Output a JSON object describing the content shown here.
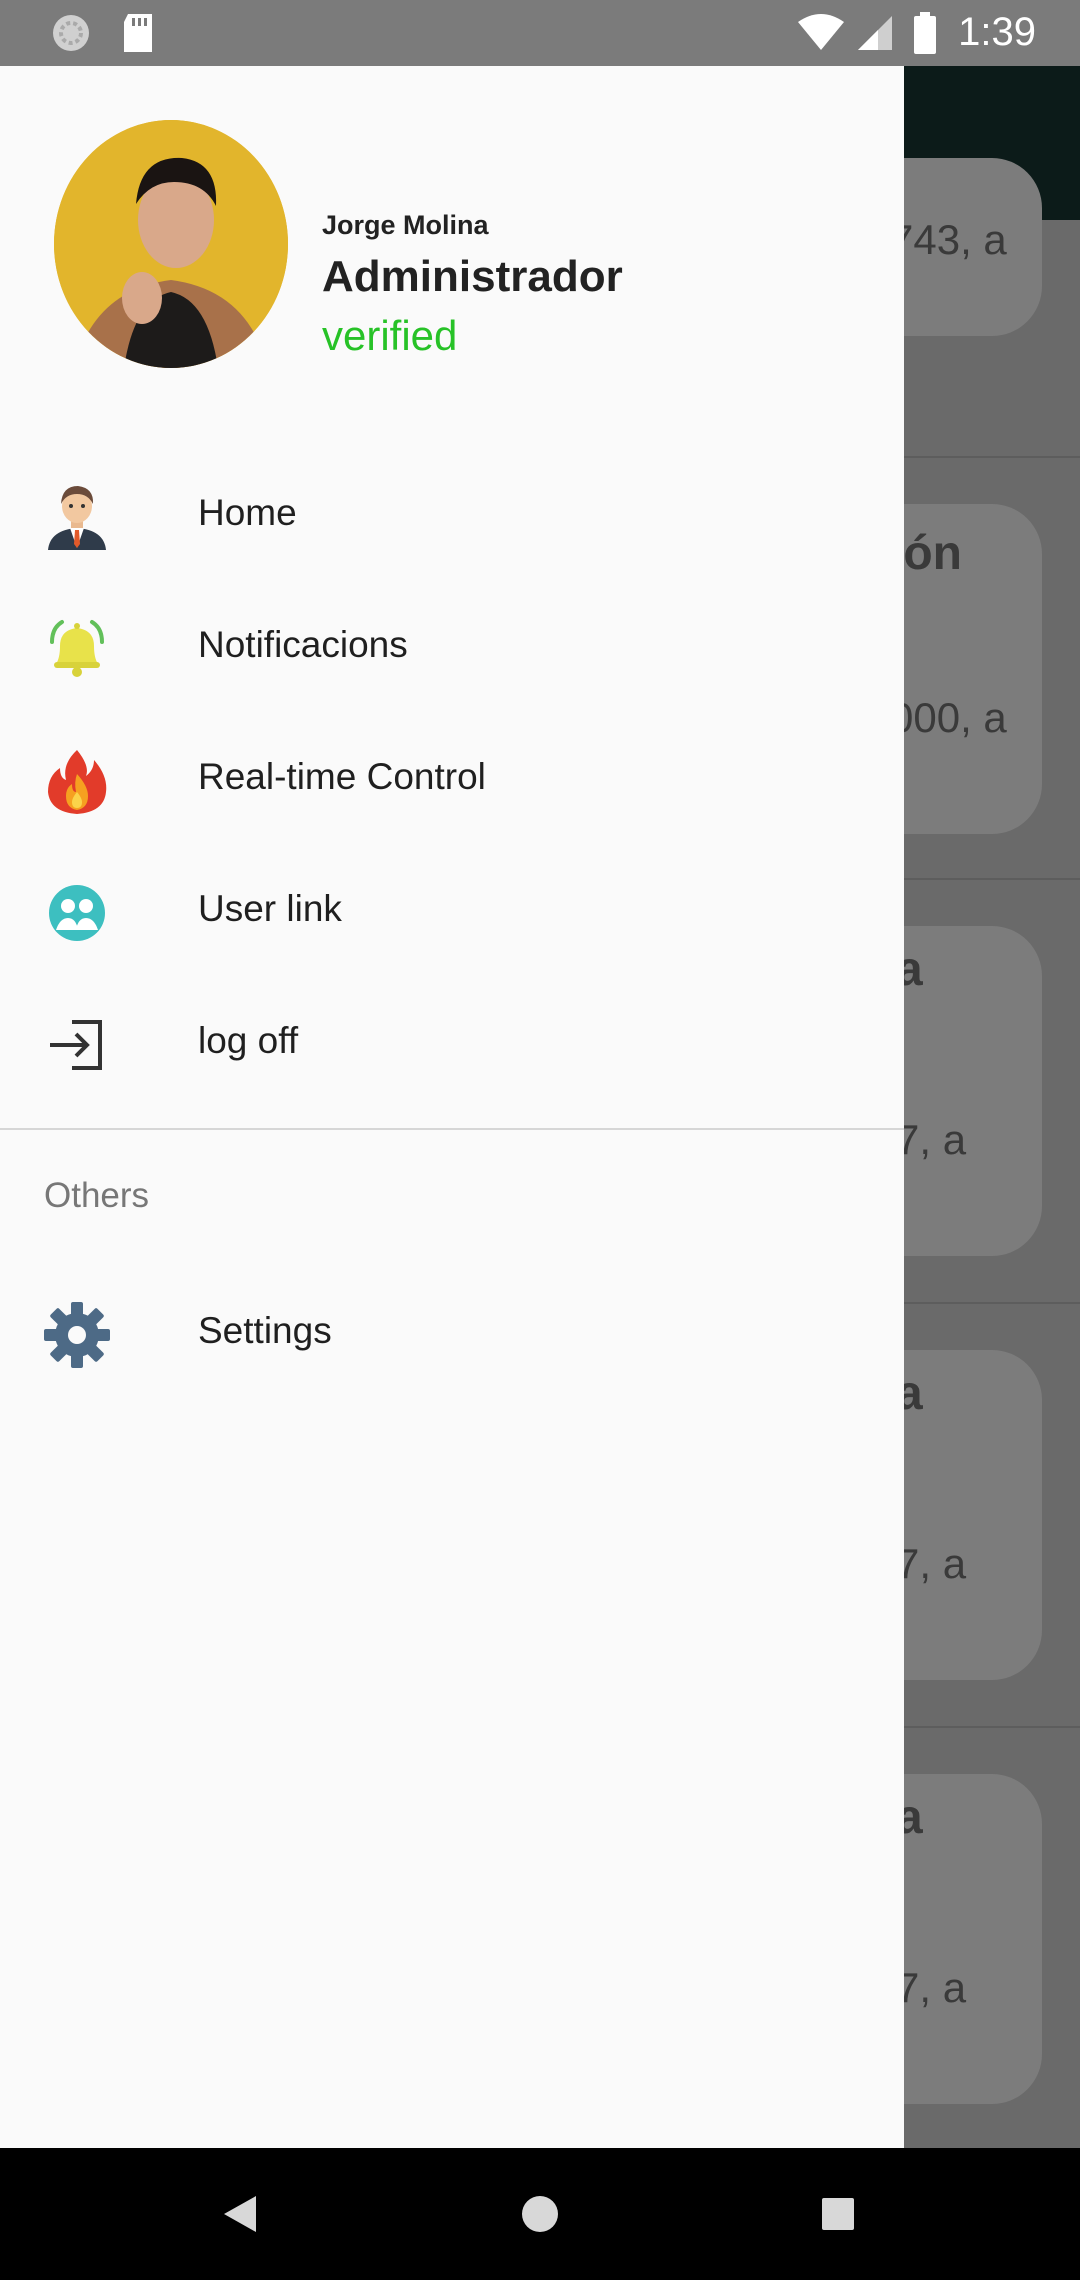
{
  "status_bar": {
    "time": "1:39"
  },
  "background": {
    "cards": [
      {
        "title": "",
        "subtitle": "743, a"
      },
      {
        "title": "ión",
        "subtitle": "000, a"
      },
      {
        "title": "a",
        "subtitle": "7, a"
      },
      {
        "title": "a",
        "subtitle": "7, a"
      },
      {
        "title": "a",
        "subtitle": "7, a"
      }
    ]
  },
  "drawer": {
    "user": {
      "name": "Jorge Molina",
      "role": "Administrador",
      "status": "verified"
    },
    "menu": [
      {
        "label": "Home",
        "icon": "businessman-icon"
      },
      {
        "label": "Notificacions",
        "icon": "bell-icon"
      },
      {
        "label": "Real-time Control",
        "icon": "fire-icon"
      },
      {
        "label": "User link",
        "icon": "user-link-icon"
      },
      {
        "label": "log off",
        "icon": "logout-icon"
      }
    ],
    "others_title": "Others",
    "others": [
      {
        "label": "Settings",
        "icon": "gear-icon"
      }
    ]
  },
  "colors": {
    "verified": "#27c227",
    "drawer_bg": "#fafafa",
    "scrim": "#6a6a6a"
  }
}
